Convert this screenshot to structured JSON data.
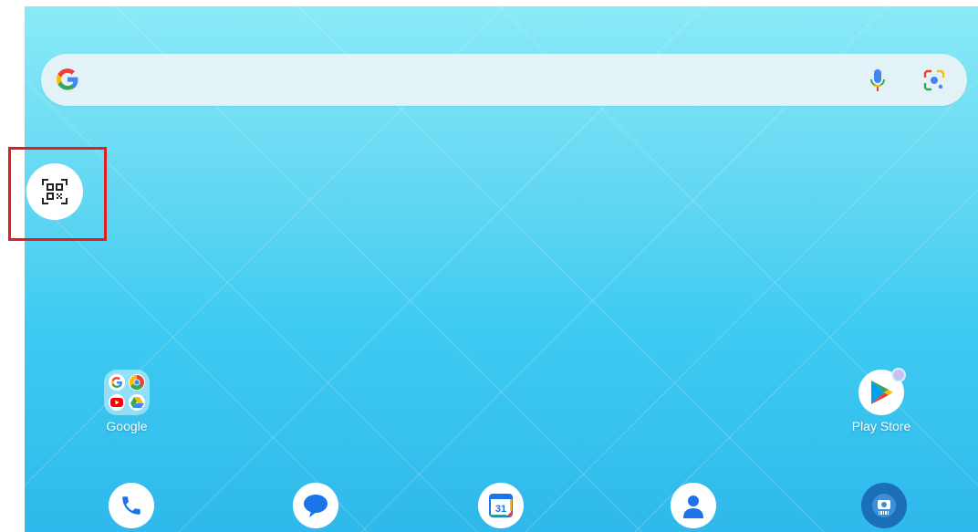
{
  "home": {
    "apps": [
      {
        "label": "Google"
      },
      {
        "label": "Play Store"
      }
    ]
  },
  "dock": [
    "phone-icon",
    "messages-icon",
    "calendar-icon",
    "contacts-icon",
    "camera-icon"
  ],
  "calendar_day": "31",
  "colors": {
    "highlight": "#e02020",
    "wallpaper_top": "#8aeaf7",
    "wallpaper_bottom": "#2fb9ec"
  }
}
